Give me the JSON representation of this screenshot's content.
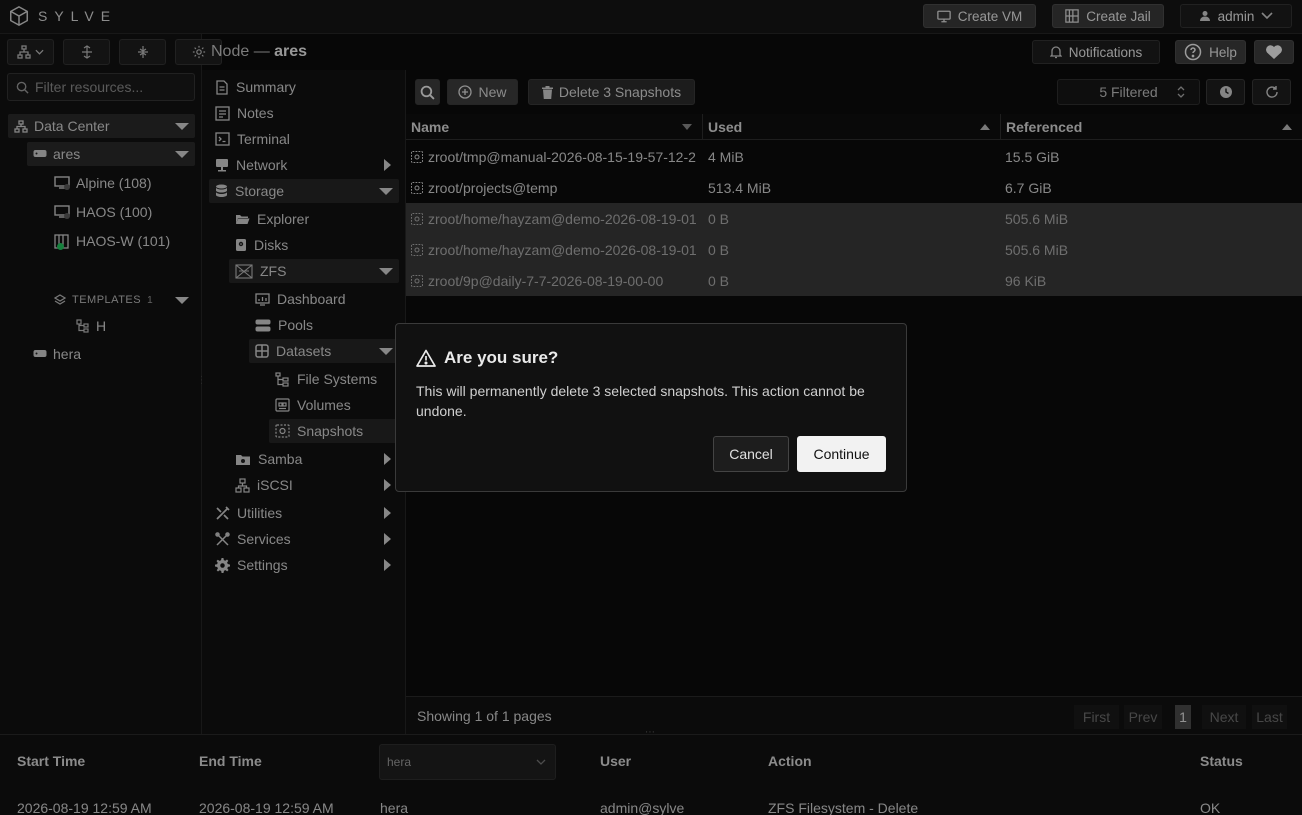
{
  "app": {
    "logo_text": "SYLVE"
  },
  "topbar": {
    "create_vm": "Create VM",
    "create_jail": "Create Jail",
    "user": "admin"
  },
  "nodebar": {
    "prefix": "Node —",
    "node": "ares",
    "notifications": "Notifications",
    "help": "Help"
  },
  "sidebar": {
    "filter_placeholder": "Filter resources...",
    "datacenter": "Data Center",
    "node_ares": "ares",
    "vms": [
      {
        "label": "Alpine (108)"
      },
      {
        "label": "HAOS (100)"
      },
      {
        "label": "HAOS-W (101)"
      }
    ],
    "templates_label": "TEMPLATES",
    "templates_count": "1",
    "template_item": "H",
    "node_hera": "hera"
  },
  "menu": {
    "summary": "Summary",
    "notes": "Notes",
    "terminal": "Terminal",
    "network": "Network",
    "storage": "Storage",
    "explorer": "Explorer",
    "disks": "Disks",
    "zfs": "ZFS",
    "dashboard": "Dashboard",
    "pools": "Pools",
    "datasets": "Datasets",
    "file_systems": "File Systems",
    "volumes": "Volumes",
    "snapshots": "Snapshots",
    "samba": "Samba",
    "iscsi": "iSCSI",
    "utilities": "Utilities",
    "services": "Services",
    "settings": "Settings"
  },
  "toolbar": {
    "new": "New",
    "delete": "Delete 3 Snapshots",
    "filter_select": "5 Filtered"
  },
  "table": {
    "columns": {
      "name": "Name",
      "used": "Used",
      "referenced": "Referenced"
    },
    "rows": [
      {
        "name": "zroot/tmp@manual-2026-08-15-19-57-12-2",
        "used": "4 MiB",
        "referenced": "15.5 GiB",
        "selected": false
      },
      {
        "name": "zroot/projects@temp",
        "used": "513.4 MiB",
        "referenced": "6.7 GiB",
        "selected": false
      },
      {
        "name": "zroot/home/hayzam@demo-2026-08-19-01",
        "used": "0 B",
        "referenced": "505.6 MiB",
        "selected": true
      },
      {
        "name": "zroot/home/hayzam@demo-2026-08-19-01",
        "used": "0 B",
        "referenced": "505.6 MiB",
        "selected": true
      },
      {
        "name": "zroot/9p@daily-7-7-2026-08-19-00-00",
        "used": "0 B",
        "referenced": "96 KiB",
        "selected": true
      }
    ]
  },
  "footer": {
    "showing": "Showing 1 of 1 pages",
    "first": "First",
    "prev": "Prev",
    "page": "1",
    "next": "Next",
    "last": "Last"
  },
  "bottom": {
    "headers": {
      "start": "Start Time",
      "end": "End Time",
      "node_select": "hera",
      "user": "User",
      "action": "Action",
      "status": "Status"
    },
    "row": {
      "start": "2026-08-19 12:59 AM",
      "end": "2026-08-19 12:59 AM",
      "node": "hera",
      "user": "admin@sylve",
      "action": "ZFS Filesystem - Delete",
      "status": "OK"
    }
  },
  "dialog": {
    "title": "Are you sure?",
    "body": "This will permanently delete 3 selected snapshots. This action cannot be undone.",
    "cancel": "Cancel",
    "continue": "Continue"
  }
}
